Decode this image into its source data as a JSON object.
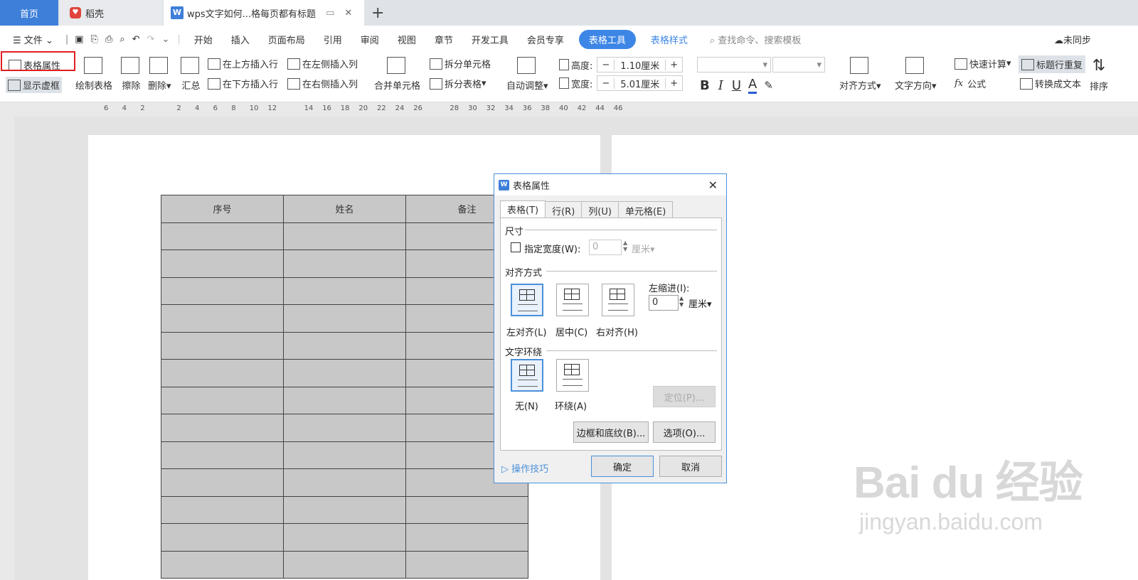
{
  "tabs": {
    "home": "首页",
    "daoke": "稻壳",
    "doc": "wps文字如何...格每页都有标题",
    "add": "+"
  },
  "menu": {
    "file": "文件",
    "items": [
      "开始",
      "插入",
      "页面布局",
      "引用",
      "审阅",
      "视图",
      "章节",
      "开发工具",
      "会员专享"
    ],
    "table_tools": "表格工具",
    "table_style": "表格样式",
    "search_placeholder": "查找命令、搜索模板",
    "sync": "未同步"
  },
  "toolbar": {
    "table_props": "表格属性",
    "show_gridlines": "显示虚框",
    "draw_table": "绘制表格",
    "erase": "擦除",
    "delete": "删除",
    "summary": "汇总",
    "insert_above": "在上方插入行",
    "insert_below": "在下方插入行",
    "insert_left": "在左侧插入列",
    "insert_right": "在右侧插入列",
    "merge_cells": "合并单元格",
    "split_cells": "拆分单元格",
    "split_table": "拆分表格",
    "auto_fit": "自动调整",
    "height_label": "高度:",
    "height_value": "1.10厘米",
    "width_label": "宽度:",
    "width_value": "5.01厘米",
    "align": "对齐方式",
    "text_direction": "文字方向",
    "quick_calc": "快速计算",
    "formula": "公式",
    "repeat_header": "标题行重复",
    "to_text": "转换成文本",
    "sort": "排序",
    "bold": "B",
    "italic": "I",
    "underline": "U",
    "font_color": "A",
    "minus": "−",
    "plus": "+"
  },
  "ruler_ticks": [
    "6",
    "4",
    "2",
    "",
    "2",
    "4",
    "6",
    "8",
    "10",
    "12",
    "",
    "14",
    "16",
    "18",
    "20",
    "22",
    "24",
    "26",
    "",
    "28",
    "30",
    "32",
    "34",
    "36",
    "38",
    "40",
    "42",
    "44",
    "46"
  ],
  "table": {
    "headers": [
      "序号",
      "姓名",
      "备注"
    ]
  },
  "dialog": {
    "title": "表格属性",
    "tabs": [
      "表格(T)",
      "行(R)",
      "列(U)",
      "单元格(E)"
    ],
    "size_section": "尺寸",
    "specify_width": "指定宽度(W):",
    "width_value": "0",
    "width_unit": "厘米",
    "align_section": "对齐方式",
    "align_left": "左对齐(L)",
    "align_center": "居中(C)",
    "align_right": "右对齐(H)",
    "left_indent": "左缩进(I):",
    "indent_value": "0",
    "indent_unit": "厘米",
    "wrap_section": "文字环绕",
    "wrap_none": "无(N)",
    "wrap_around": "环绕(A)",
    "position_btn": "定位(P)...",
    "borders_btn": "边框和底纹(B)...",
    "options_btn": "选项(O)...",
    "tips": "操作技巧",
    "ok": "确定",
    "cancel": "取消"
  },
  "watermark": {
    "brand": "Bai du 经验",
    "url": "jingyan.baidu.com"
  },
  "colors": {
    "accent": "#3d86e6",
    "highlight_box": "#e02020",
    "table_fill": "#c8c8c8"
  }
}
